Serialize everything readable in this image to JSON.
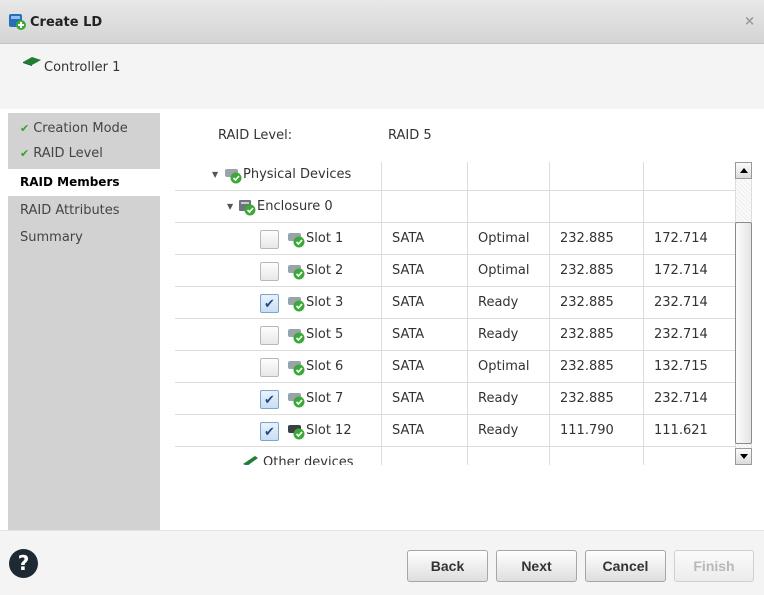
{
  "window": {
    "title": "Create LD",
    "close_glyph": "×"
  },
  "controller": {
    "label": "Controller 1",
    "icon": "controller-icon"
  },
  "sidebar": {
    "items": [
      {
        "label": "Creation Mode",
        "state": "done"
      },
      {
        "label": "RAID Level",
        "state": "done"
      },
      {
        "label": "RAID Members",
        "state": "active"
      },
      {
        "label": "RAID Attributes",
        "state": "pending"
      },
      {
        "label": "Summary",
        "state": "pending"
      }
    ],
    "check_glyph": "✔"
  },
  "raid": {
    "level_label": "RAID Level:",
    "level_value": "RAID 5"
  },
  "tree": {
    "physical_devices": "Physical Devices",
    "enclosure": "Enclosure 0",
    "slots": [
      {
        "name": "Slot 1",
        "checked": false,
        "bus": "SATA",
        "state": "Optimal",
        "size": "232.885",
        "free": "172.714"
      },
      {
        "name": "Slot 2",
        "checked": false,
        "bus": "SATA",
        "state": "Optimal",
        "size": "232.885",
        "free": "172.714"
      },
      {
        "name": "Slot 3",
        "checked": true,
        "bus": "SATA",
        "state": "Ready",
        "size": "232.885",
        "free": "232.714"
      },
      {
        "name": "Slot 5",
        "checked": false,
        "bus": "SATA",
        "state": "Ready",
        "size": "232.885",
        "free": "232.714"
      },
      {
        "name": "Slot 6",
        "checked": false,
        "bus": "SATA",
        "state": "Optimal",
        "size": "232.885",
        "free": "132.715"
      },
      {
        "name": "Slot 7",
        "checked": true,
        "bus": "SATA",
        "state": "Ready",
        "size": "232.885",
        "free": "232.714"
      },
      {
        "name": "Slot 12",
        "checked": true,
        "bus": "SATA",
        "state": "Ready",
        "size": "111.790",
        "free": "111.621"
      }
    ],
    "other_devices": "Other devices",
    "expand_glyph": "▼"
  },
  "buttons": {
    "back": "Back",
    "next": "Next",
    "cancel": "Cancel",
    "finish": "Finish"
  },
  "help": {
    "glyph": "?"
  },
  "colors": {
    "ok_green": "#3a9d2e",
    "controller_green": "#1e7e34",
    "disabled_text": "#b8b8b8"
  }
}
